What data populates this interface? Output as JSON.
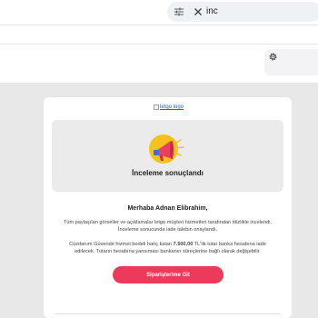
{
  "search": {
    "tune_icon": "tune-icon",
    "clear_icon": "close-icon",
    "query": "inc"
  },
  "toolbar": {
    "settings_icon": "gear-icon"
  },
  "email": {
    "logo_alt": "letgo logo",
    "hero_icon": "megaphone-icon",
    "hero_title": "İnceleme sonuçlandı",
    "greeting": "Merhaba Adnan Elibrahim,",
    "paragraph1": "Tüm paylaşılan görseller ve açıklamalar letgo müşteri hizmetleri tarafından titizlikle incelendi. İnceleme sonucunda iade talebin onaylandı.",
    "paragraph2_before": "Cüzdanım Güvende hizmet bedeli hariç kalan ",
    "paragraph2_amount": "7.500,00",
    "paragraph2_after": " TL'lik tutar banka hesabına iade edilecek. Tutarın hesabına yansıması bankanın süreçlerine bağlı olarak değişebilir.",
    "cta_label": "Siparişlerime Git",
    "colors": {
      "cta": "#ee3a5a",
      "background": "#e8e8e8",
      "hero_bg": "#ebebeb"
    }
  }
}
